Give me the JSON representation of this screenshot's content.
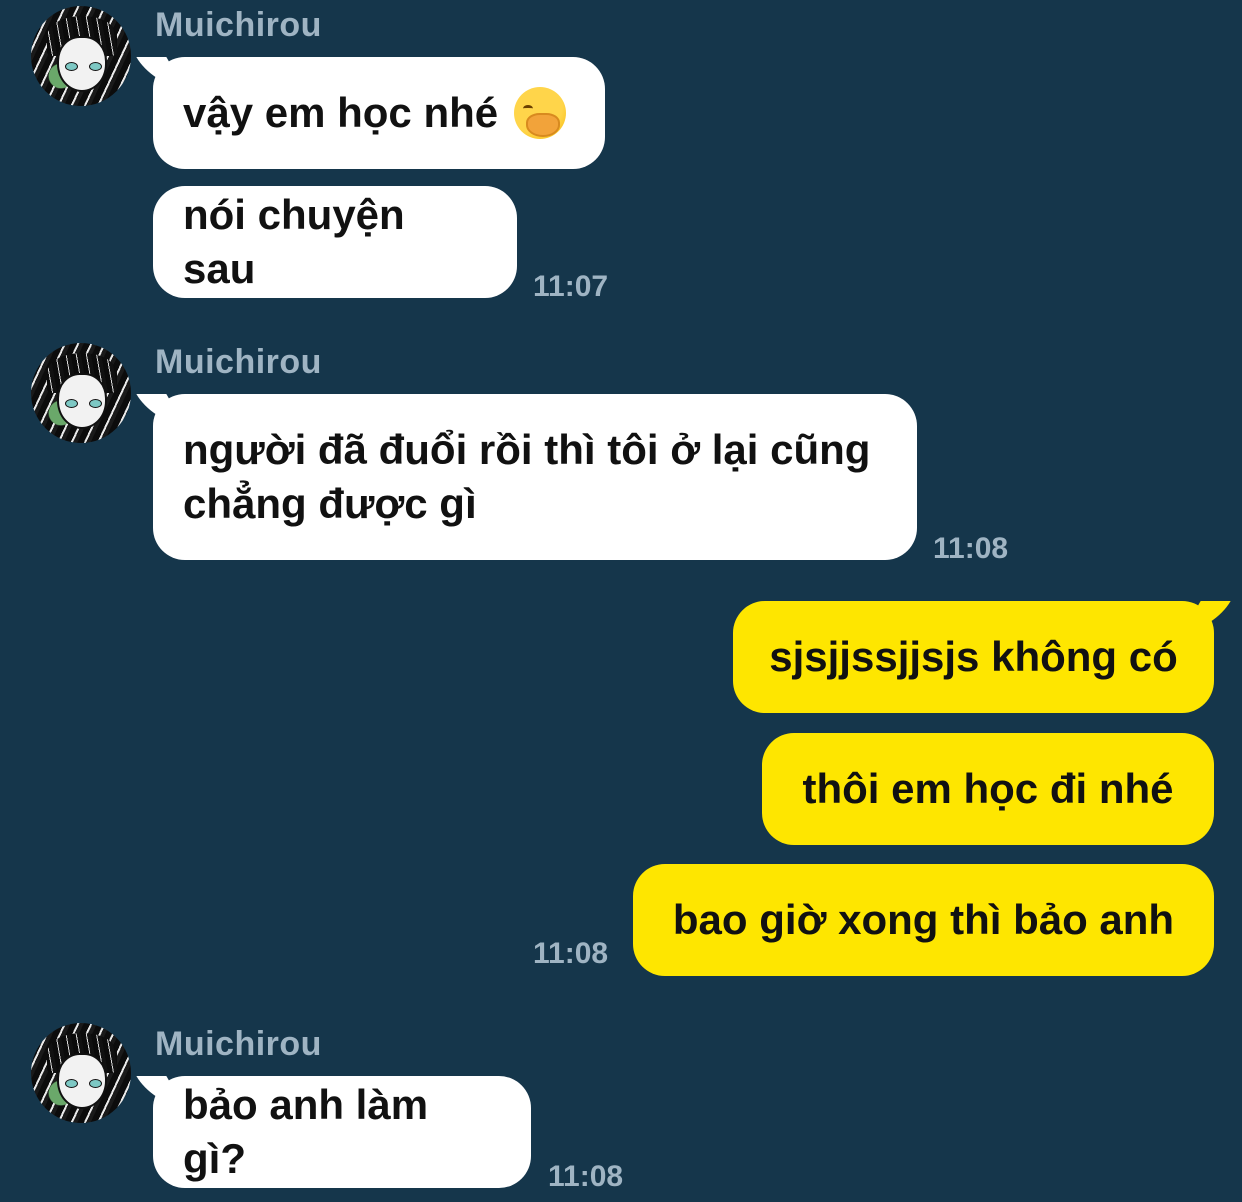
{
  "contact": {
    "name": "Muichirou"
  },
  "messages": [
    {
      "text": "vậy em học nhé"
    },
    {
      "text": "nói chuyện sau",
      "time": "11:07"
    },
    {
      "text": "người đã đuổi rồi thì tôi ở lại cũng chẳng được gì",
      "time": "11:08"
    },
    {
      "text": "sjsjjssjjsjs không có"
    },
    {
      "text": "thôi em học đi nhé"
    },
    {
      "text": "bao giờ xong thì bảo anh",
      "time": "11:08"
    },
    {
      "text": "bảo anh làm gì?",
      "time": "11:08"
    }
  ],
  "icons": {
    "avatar": "profile-avatar",
    "emoji": "yawning-face-emoji"
  },
  "colors": {
    "background": "#15364b",
    "incoming_bubble": "#ffffff",
    "outgoing_bubble": "#fee600",
    "meta_text": "#9fb4c3"
  }
}
